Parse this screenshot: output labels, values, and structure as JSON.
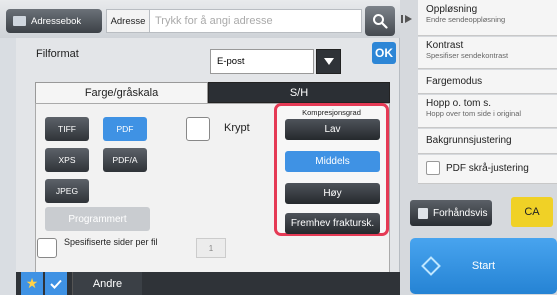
{
  "topbar": {
    "addressbook_label": "Adressebok",
    "address_label": "Adresse",
    "address_placeholder": "Trykk for å angi adresse"
  },
  "panel": {
    "filformat_label": "Filformat",
    "filformat_value": "E-post",
    "ok_label": "OK",
    "tabs": [
      {
        "label": "Farge/gråskala"
      },
      {
        "label": "S/H"
      }
    ],
    "formats": [
      {
        "label": "TIFF",
        "selected": false
      },
      {
        "label": "PDF",
        "selected": true
      },
      {
        "label": "XPS",
        "selected": false
      },
      {
        "label": "PDF/A",
        "selected": false
      },
      {
        "label": "JPEG",
        "selected": false
      }
    ],
    "krypt_label": "Krypt",
    "programmert_label": "Programmert",
    "compression": {
      "title": "Kompresjonsgrad",
      "options": [
        {
          "label": "Lav",
          "selected": false
        },
        {
          "label": "Middels",
          "selected": true
        },
        {
          "label": "Høy",
          "selected": false
        },
        {
          "label": "Fremhev fraktursk.",
          "selected": false
        }
      ]
    },
    "specified_pages_label": "Spesifiserte sider per fil",
    "specified_pages_value": "1"
  },
  "bottombar": {
    "andre_label": "Andre"
  },
  "right": {
    "items": [
      {
        "title": "Oppløsning",
        "sub": "Endre sendeoppløsning"
      },
      {
        "title": "Kontrast",
        "sub": "Spesifiser sendekontrast"
      },
      {
        "title": "Fargemodus",
        "sub": ""
      },
      {
        "title": "Hopp o. tom s.",
        "sub": "Hopp over tom side i original"
      },
      {
        "title": "Bakgrunnsjustering",
        "sub": ""
      },
      {
        "title": "PDF skrå-justering",
        "sub": ""
      }
    ],
    "preview_label": "Forhåndsvis",
    "ca_label": "CA",
    "start_label": "Start"
  },
  "colors": {
    "accent_blue": "#3f92e4",
    "highlight_red": "#e53a55",
    "ca_yellow": "#f0d126"
  }
}
